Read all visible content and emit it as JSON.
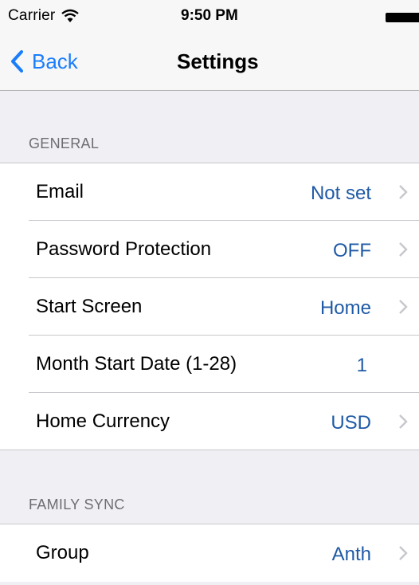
{
  "status_bar": {
    "carrier": "Carrier",
    "time": "9:50 PM"
  },
  "nav": {
    "back_label": "Back",
    "title": "Settings"
  },
  "sections": [
    {
      "header": "GENERAL",
      "rows": [
        {
          "label": "Email",
          "value": "Not set",
          "chevron": true
        },
        {
          "label": "Password Protection",
          "value": "OFF",
          "chevron": true
        },
        {
          "label": "Start Screen",
          "value": "Home",
          "chevron": true
        },
        {
          "label": "Month Start Date (1-28)",
          "value": "1",
          "chevron": false
        },
        {
          "label": "Home Currency",
          "value": "USD",
          "chevron": true
        }
      ]
    },
    {
      "header": "FAMILY SYNC",
      "rows": [
        {
          "label": "Group",
          "value": "Anth",
          "chevron": true
        }
      ]
    }
  ],
  "colors": {
    "accent": "#1a7dfb",
    "value_text": "#1f5aa6",
    "section_header": "#6d6d72",
    "background": "#efeff4"
  }
}
